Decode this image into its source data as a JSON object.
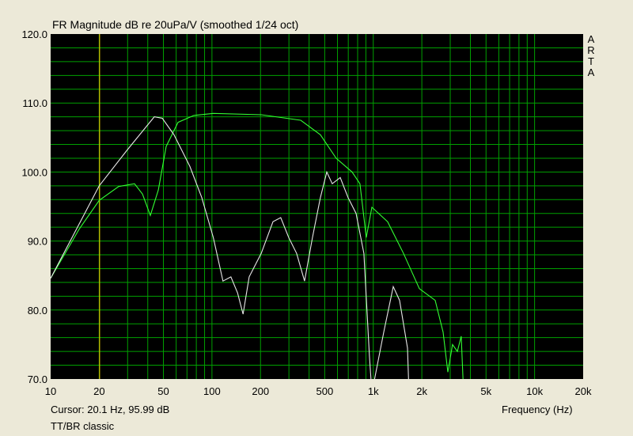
{
  "chart_data": {
    "type": "line",
    "title": "FR Magnitude dB re 20uPa/V (smoothed 1/24 oct)",
    "xlabel": "Frequency (Hz)",
    "ylabel": "",
    "xscale": "log",
    "xlim": [
      10,
      20000
    ],
    "ylim": [
      70,
      120
    ],
    "y_ticks": [
      "120.0",
      "110.0",
      "100.0",
      "90.0",
      "80.0",
      "70.0"
    ],
    "y_tick_values": [
      120,
      110,
      100,
      90,
      80,
      70
    ],
    "x_ticks": [
      "10",
      "20",
      "50",
      "100",
      "200",
      "500",
      "1k",
      "2k",
      "5k",
      "10k",
      "20k"
    ],
    "x_tick_values": [
      10,
      20,
      50,
      100,
      200,
      500,
      1000,
      2000,
      5000,
      10000,
      20000
    ],
    "grid": true,
    "background": "#000000",
    "grid_color": "#00a000",
    "cursor": {
      "freq": 20.1,
      "color": "#e0c000"
    },
    "series": [
      {
        "name": "green",
        "color": "#33ff33",
        "x": [
          10,
          15,
          20,
          26.4,
          33.1,
          37.1,
          41.5,
          46.5,
          52,
          61.6,
          77.2,
          102,
          202,
          355,
          470,
          589,
          739,
          827,
          905,
          980,
          1228,
          1540,
          1930,
          2420,
          2710,
          2900,
          3100,
          3320,
          3510,
          3630
        ],
        "y": [
          84.6,
          91.7,
          95.9,
          97.9,
          98.3,
          96.8,
          93.7,
          97.4,
          103.7,
          107.2,
          108.2,
          108.5,
          108.3,
          107.5,
          105.4,
          102,
          100,
          98.3,
          90.5,
          94.9,
          92.8,
          88.2,
          83.1,
          81.4,
          76.8,
          71,
          75,
          74,
          76.2,
          68
        ]
      },
      {
        "name": "white",
        "color": "#e8e8e8",
        "x": [
          10,
          20,
          29.6,
          43.9,
          49.2,
          58.2,
          73,
          86.5,
          102,
          117,
          131,
          144,
          156,
          170,
          202,
          239,
          267,
          299,
          335,
          375,
          420,
          470,
          515,
          557,
          624,
          698,
          782,
          875,
          947,
          980,
          1161,
          1330,
          1455,
          1630,
          1666
        ],
        "y": [
          84.6,
          98,
          103.1,
          108,
          107.8,
          105.4,
          100.8,
          96.3,
          90.5,
          84.2,
          84.8,
          82.5,
          79.4,
          84.8,
          88.2,
          92.8,
          93.4,
          90.5,
          88.2,
          84.2,
          90.5,
          96.3,
          100,
          98.3,
          99.2,
          96.3,
          94,
          88.2,
          73.3,
          68,
          76.8,
          83.4,
          81.4,
          74.5,
          68
        ]
      }
    ]
  },
  "labels": {
    "cursor_readout": "Cursor: 20.1 Hz, 95.99 dB",
    "mode": "TT/BR classic",
    "arta": [
      "A",
      "R",
      "T",
      "A"
    ]
  }
}
